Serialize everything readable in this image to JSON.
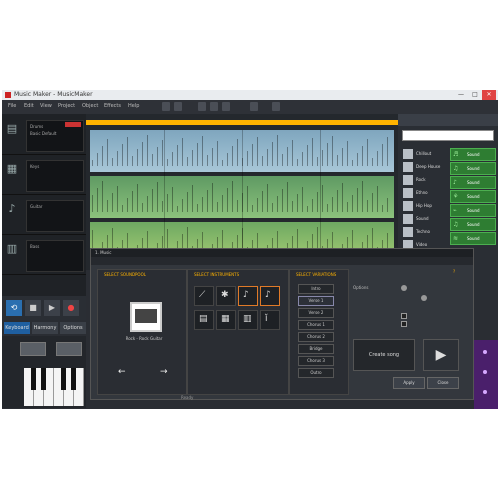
{
  "window": {
    "title": "Music Maker - MusicMaker",
    "controls": [
      "—",
      "□",
      "✕"
    ]
  },
  "menu": {
    "items": [
      "File",
      "Edit",
      "View",
      "Project",
      "Object",
      "Effects",
      "Help"
    ]
  },
  "tracks": [
    {
      "icon": "drum-icon",
      "glyph": "▤",
      "name": "Drums",
      "subtitle": "Basic Default"
    },
    {
      "icon": "keyboard-icon",
      "glyph": "▦",
      "name": "Keys",
      "subtitle": ""
    },
    {
      "icon": "guitar-icon",
      "glyph": "♪",
      "name": "Guitar",
      "subtitle": ""
    },
    {
      "icon": "bass-icon",
      "glyph": "▥",
      "name": "Bass",
      "subtitle": ""
    }
  ],
  "transport": {
    "loop": "⟲",
    "stop": "■",
    "play": "▶",
    "record": "●"
  },
  "bottom_tabs": [
    "Keyboard",
    "Harmony",
    "Options"
  ],
  "library": {
    "items": [
      "Chillout",
      "Deep House",
      "Rock",
      "Ethno",
      "Hip Hop",
      "Sound",
      "Techno",
      "Video"
    ],
    "instruments": [
      {
        "glyph": "♬",
        "label": "Sound"
      },
      {
        "glyph": "♫",
        "label": "Sound"
      },
      {
        "glyph": "♪",
        "label": "Sound"
      },
      {
        "glyph": "⚘",
        "label": "Sound"
      },
      {
        "glyph": "⌁",
        "label": "Sound"
      },
      {
        "glyph": "♫",
        "label": "Sound"
      },
      {
        "glyph": "≋",
        "label": "Sound"
      }
    ]
  },
  "dialog": {
    "title": "1. Music",
    "columns": {
      "style": "SELECT SOUNDPOOL",
      "instruments": "SELECT INSTRUMENTS",
      "variations": "SELECT VARIATIONS"
    },
    "style_name": "Rock - Rock Guitar",
    "instrument_glyphs": [
      "⟋",
      "✱",
      "♪",
      "♪",
      "▤",
      "▦",
      "▥",
      "ǐ"
    ],
    "variations": [
      "Intro",
      "Verse 1",
      "Verse 2",
      "Chorus 1",
      "Chorus 2",
      "Bridge",
      "Chorus 3",
      "Outro"
    ],
    "selected_variation": 1,
    "options_label": "Options",
    "create_label": "Create song",
    "play_glyph": "▶",
    "ok_label": "Apply",
    "cancel_label": "Close",
    "status_text": "Ready"
  }
}
